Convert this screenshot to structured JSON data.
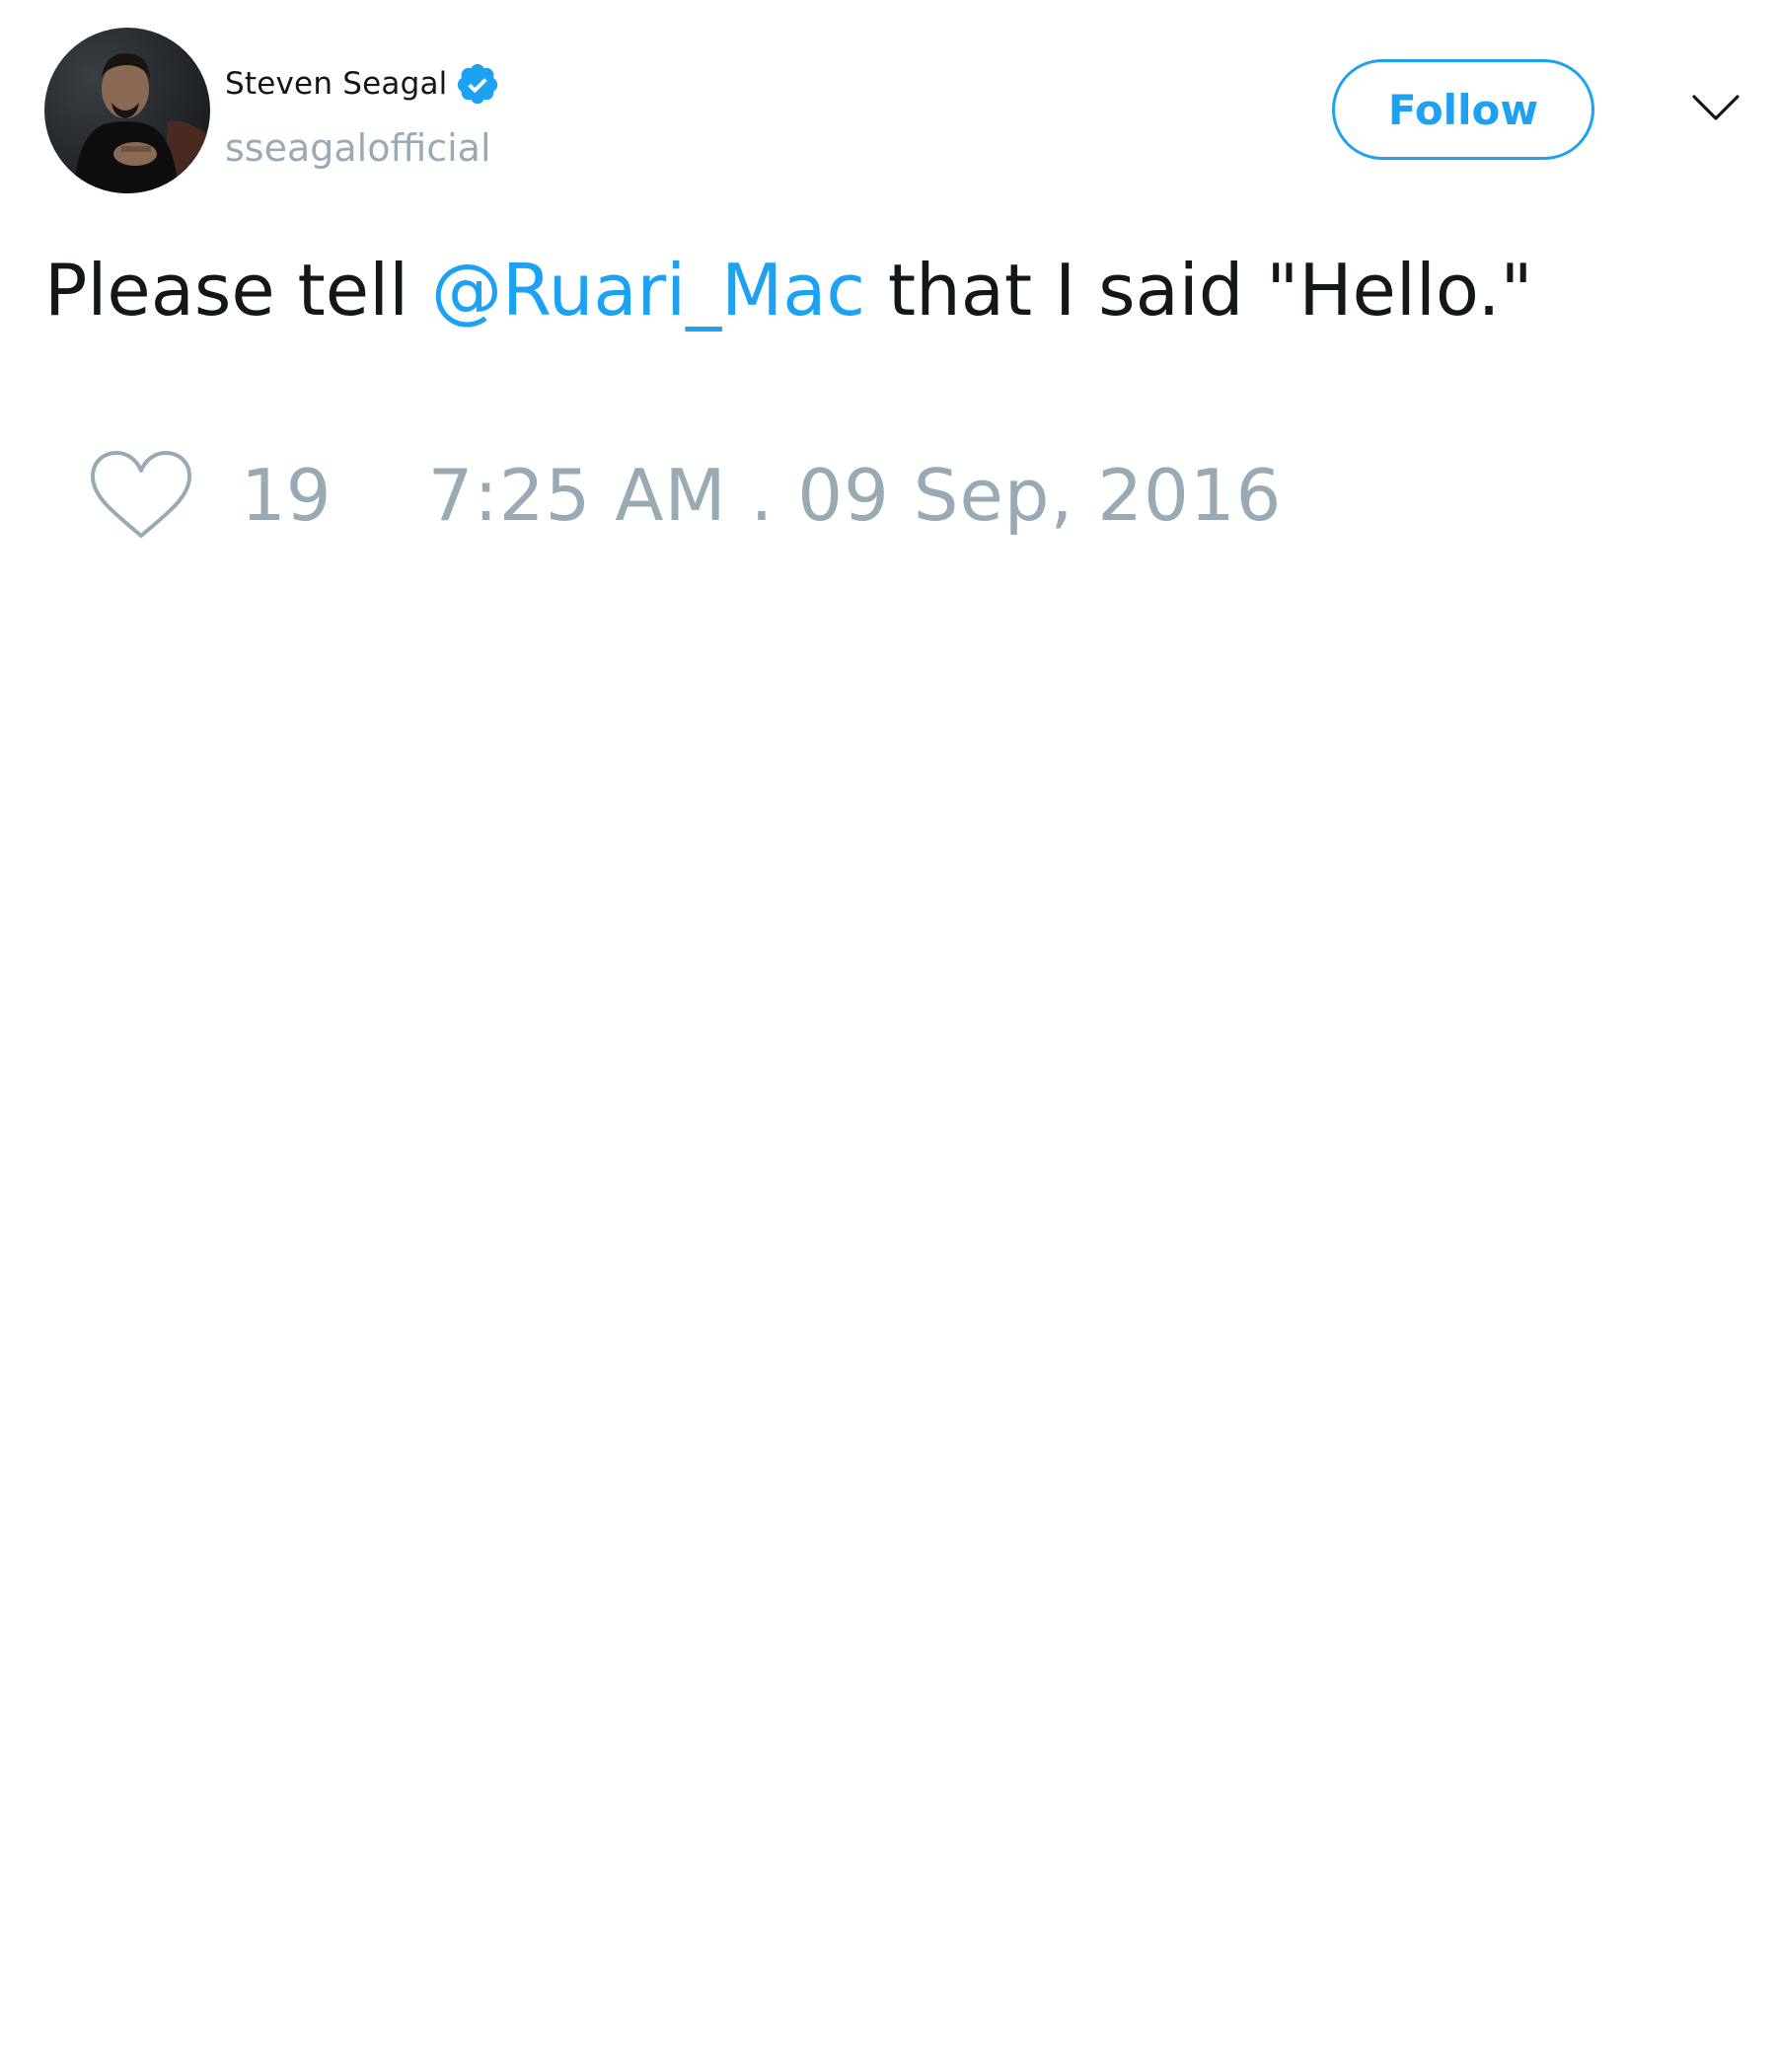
{
  "author": {
    "display_name": "Steven Seagal",
    "username": "sseagalofficial",
    "verified_icon": "verified-badge-icon",
    "avatar_icon": "profile-photo"
  },
  "header": {
    "follow_label": "Follow",
    "menu_icon": "chevron-down-icon"
  },
  "tweet": {
    "text_before": "Please tell ",
    "mention": "@Ruari_Mac",
    "text_after": " that I said \"Hello.\""
  },
  "footer": {
    "like_icon": "heart-icon",
    "like_count": "19",
    "timestamp": "7:25 AM . 09 Sep, 2016"
  },
  "colors": {
    "accent": "#1da1f2",
    "text": "#14171a",
    "muted": "#99aab5",
    "background": "#ffffff"
  }
}
